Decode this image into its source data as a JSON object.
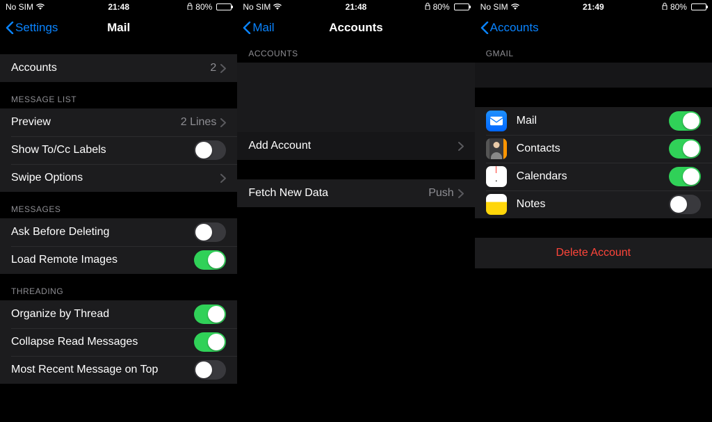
{
  "screens": [
    {
      "status": {
        "carrier": "No SIM",
        "time": "21:48",
        "battery_pct": "80%"
      },
      "nav": {
        "back": "Settings",
        "title": "Mail"
      },
      "groups": [
        {
          "header": null,
          "rows": [
            {
              "label": "Accounts",
              "value": "2",
              "type": "nav"
            }
          ]
        },
        {
          "header": "MESSAGE LIST",
          "rows": [
            {
              "label": "Preview",
              "value": "2 Lines",
              "type": "nav"
            },
            {
              "label": "Show To/Cc Labels",
              "type": "toggle",
              "on": false
            },
            {
              "label": "Swipe Options",
              "type": "nav"
            }
          ]
        },
        {
          "header": "MESSAGES",
          "rows": [
            {
              "label": "Ask Before Deleting",
              "type": "toggle",
              "on": false
            },
            {
              "label": "Load Remote Images",
              "type": "toggle",
              "on": true
            }
          ]
        },
        {
          "header": "THREADING",
          "rows": [
            {
              "label": "Organize by Thread",
              "type": "toggle",
              "on": true
            },
            {
              "label": "Collapse Read Messages",
              "type": "toggle",
              "on": true
            },
            {
              "label": "Most Recent Message on Top",
              "type": "toggle",
              "on": false
            }
          ]
        }
      ]
    },
    {
      "status": {
        "carrier": "No SIM",
        "time": "21:48",
        "battery_pct": "80%"
      },
      "nav": {
        "back": "Mail",
        "title": "Accounts"
      },
      "section_header": "ACCOUNTS",
      "add_account": "Add Account",
      "fetch": {
        "label": "Fetch New Data",
        "value": "Push"
      }
    },
    {
      "status": {
        "carrier": "No SIM",
        "time": "21:49",
        "battery_pct": "80%"
      },
      "nav": {
        "back": "Accounts",
        "title": ""
      },
      "section_header": "GMAIL",
      "services": [
        {
          "label": "Mail",
          "icon": "mail",
          "on": true
        },
        {
          "label": "Contacts",
          "icon": "contacts",
          "on": true
        },
        {
          "label": "Calendars",
          "icon": "calendar",
          "on": true
        },
        {
          "label": "Notes",
          "icon": "notes",
          "on": false
        }
      ],
      "delete": "Delete Account"
    }
  ]
}
